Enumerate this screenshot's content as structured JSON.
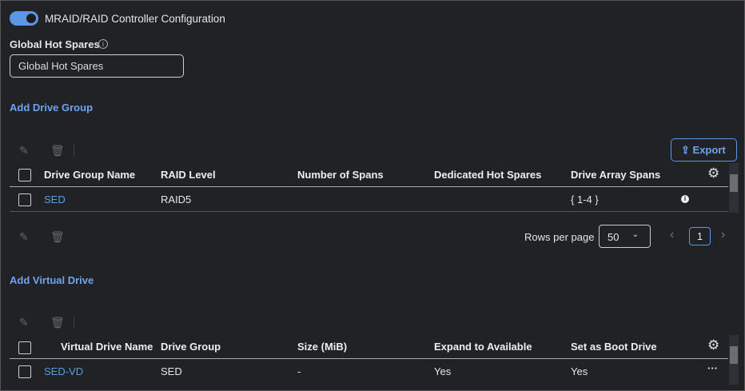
{
  "header": {
    "title": "MRAID/RAID Controller Configuration",
    "toggle_on": true
  },
  "global_hot_spares": {
    "label": "Global Hot Spares",
    "value": "Global Hot Spares"
  },
  "drive_group": {
    "add_label": "Add Drive Group",
    "export_label": "Export",
    "columns": [
      "Drive Group Name",
      "RAID Level",
      "Number of Spans",
      "Dedicated Hot Spares",
      "Drive Array Spans"
    ],
    "rows": [
      {
        "name": "SED",
        "raid": "RAID5",
        "spans": "",
        "hot_spares": "",
        "array_spans": "{ 1-4 }"
      }
    ],
    "rows_per_page_label": "Rows per page",
    "rows_per_page": "50",
    "page": "1"
  },
  "virtual_drive": {
    "add_label": "Add Virtual Drive",
    "columns": [
      "Virtual Drive Name",
      "Drive Group",
      "Size (MiB)",
      "Expand to Available",
      "Set as Boot Drive"
    ],
    "rows": [
      {
        "name": "SED-VD",
        "group": "SED",
        "size": "-",
        "expand": "Yes",
        "boot": "Yes"
      }
    ]
  },
  "colors": {
    "accent": "#5b97e6",
    "background": "#212226"
  }
}
